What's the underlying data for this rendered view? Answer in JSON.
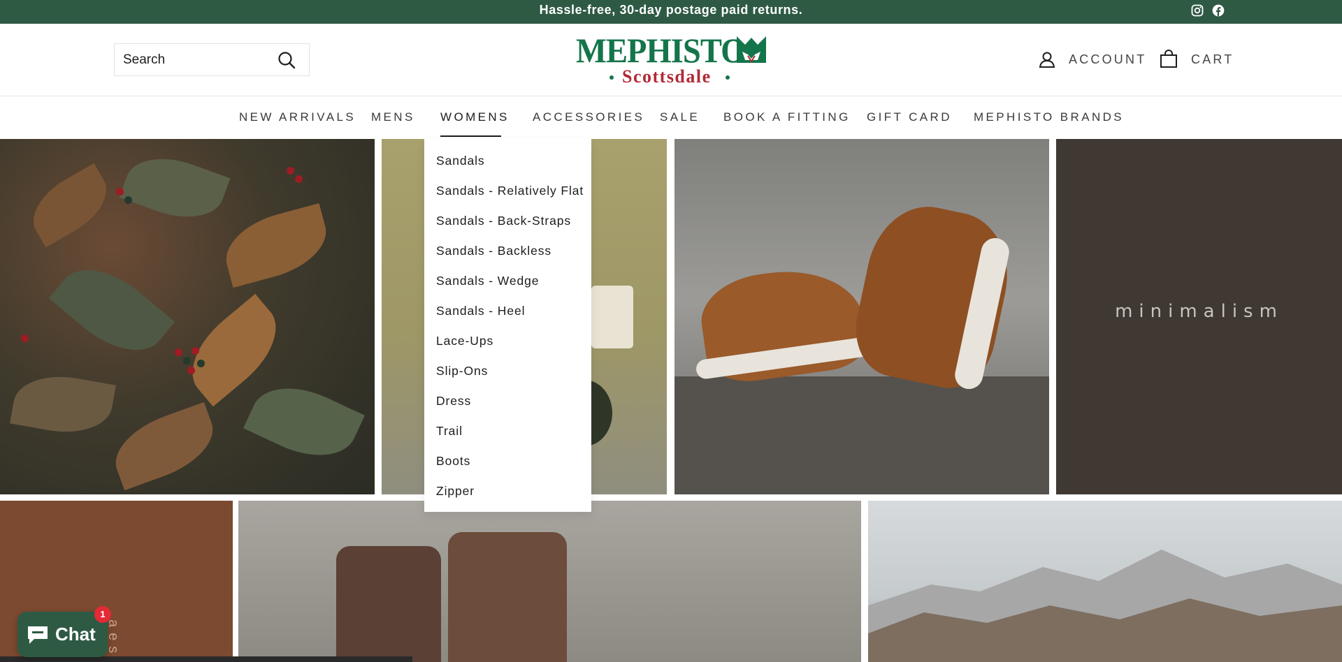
{
  "announcement": {
    "text": "Hassle-free, 30-day postage paid returns.",
    "social_icons": [
      "instagram-icon",
      "facebook-icon"
    ]
  },
  "header": {
    "search": {
      "placeholder": "Search",
      "value": ""
    },
    "logo": {
      "main": "MEPHISTO",
      "sub": "Scottsdale"
    },
    "account_label": "ACCOUNT",
    "cart_label": "CART"
  },
  "nav": {
    "items": [
      {
        "label": "NEW ARRIVALS"
      },
      {
        "label": "MENS"
      },
      {
        "label": "WOMENS",
        "active": true
      },
      {
        "label": "ACCESSORIES"
      },
      {
        "label": "SALE"
      },
      {
        "label": "BOOK A FITTING"
      },
      {
        "label": "GIFT CARD"
      },
      {
        "label": "MEPHISTO BRANDS"
      }
    ]
  },
  "womens_menu": {
    "items": [
      "Sandals",
      "Sandals - Relatively Flat",
      "Sandals - Back-Straps",
      "Sandals - Backless",
      "Sandals - Wedge",
      "Sandals - Heel",
      "Lace-Ups",
      "Slip-Ons",
      "Dress",
      "Trail",
      "Boots",
      "Zipper"
    ]
  },
  "hero": {
    "minimalism_text": "minimalism",
    "vertical_text": "aes"
  },
  "chat": {
    "label": "Chat",
    "badge": "1"
  },
  "colors": {
    "brand_green": "#2e5a44",
    "logo_green": "#15754a",
    "logo_red": "#b22a37",
    "badge_red": "#e32a36"
  }
}
